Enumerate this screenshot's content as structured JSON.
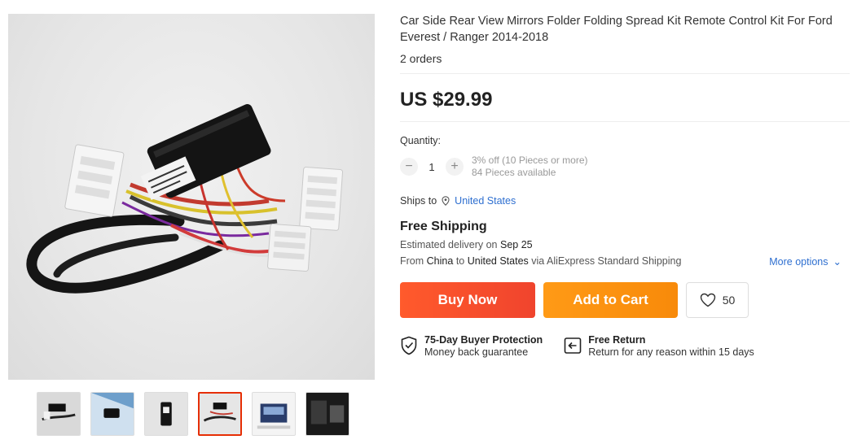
{
  "product": {
    "title": "Car Side Rear View Mirrors Folder Folding Spread Kit Remote Control Kit For Ford Everest / Ranger 2014-2018",
    "orders": "2 orders",
    "price": "US $29.99"
  },
  "quantity": {
    "label": "Quantity:",
    "value": "1",
    "decrement_icon": "minus-icon",
    "increment_icon": "plus-icon",
    "discount": "3% off (10 Pieces or more)",
    "available": "84 Pieces available"
  },
  "shipping": {
    "ships_to_label": "Ships to",
    "country": "United States",
    "free_label": "Free Shipping",
    "estimated_prefix": "Estimated delivery on",
    "estimated_date": "Sep 25",
    "from_prefix": "From",
    "from_country": "China",
    "to_word": "to",
    "to_country": "United States",
    "via": "via AliExpress Standard Shipping",
    "more_options": "More options"
  },
  "actions": {
    "buy_now": "Buy Now",
    "add_to_cart": "Add to Cart",
    "wishlist_count": "50"
  },
  "guarantees": [
    {
      "title": "75-Day Buyer Protection",
      "sub": "Money back guarantee",
      "icon": "shield-check-icon"
    },
    {
      "title": "Free Return",
      "sub": "Return for any reason within 15 days",
      "icon": "return-icon"
    }
  ],
  "gallery": {
    "thumbnail_count": 6,
    "active_thumbnail": 4
  },
  "colors": {
    "buy_now": "#f0442d",
    "add_to_cart": "#f88a0a",
    "link": "#2e6fd0",
    "active_thumb_border": "#e62e04"
  }
}
